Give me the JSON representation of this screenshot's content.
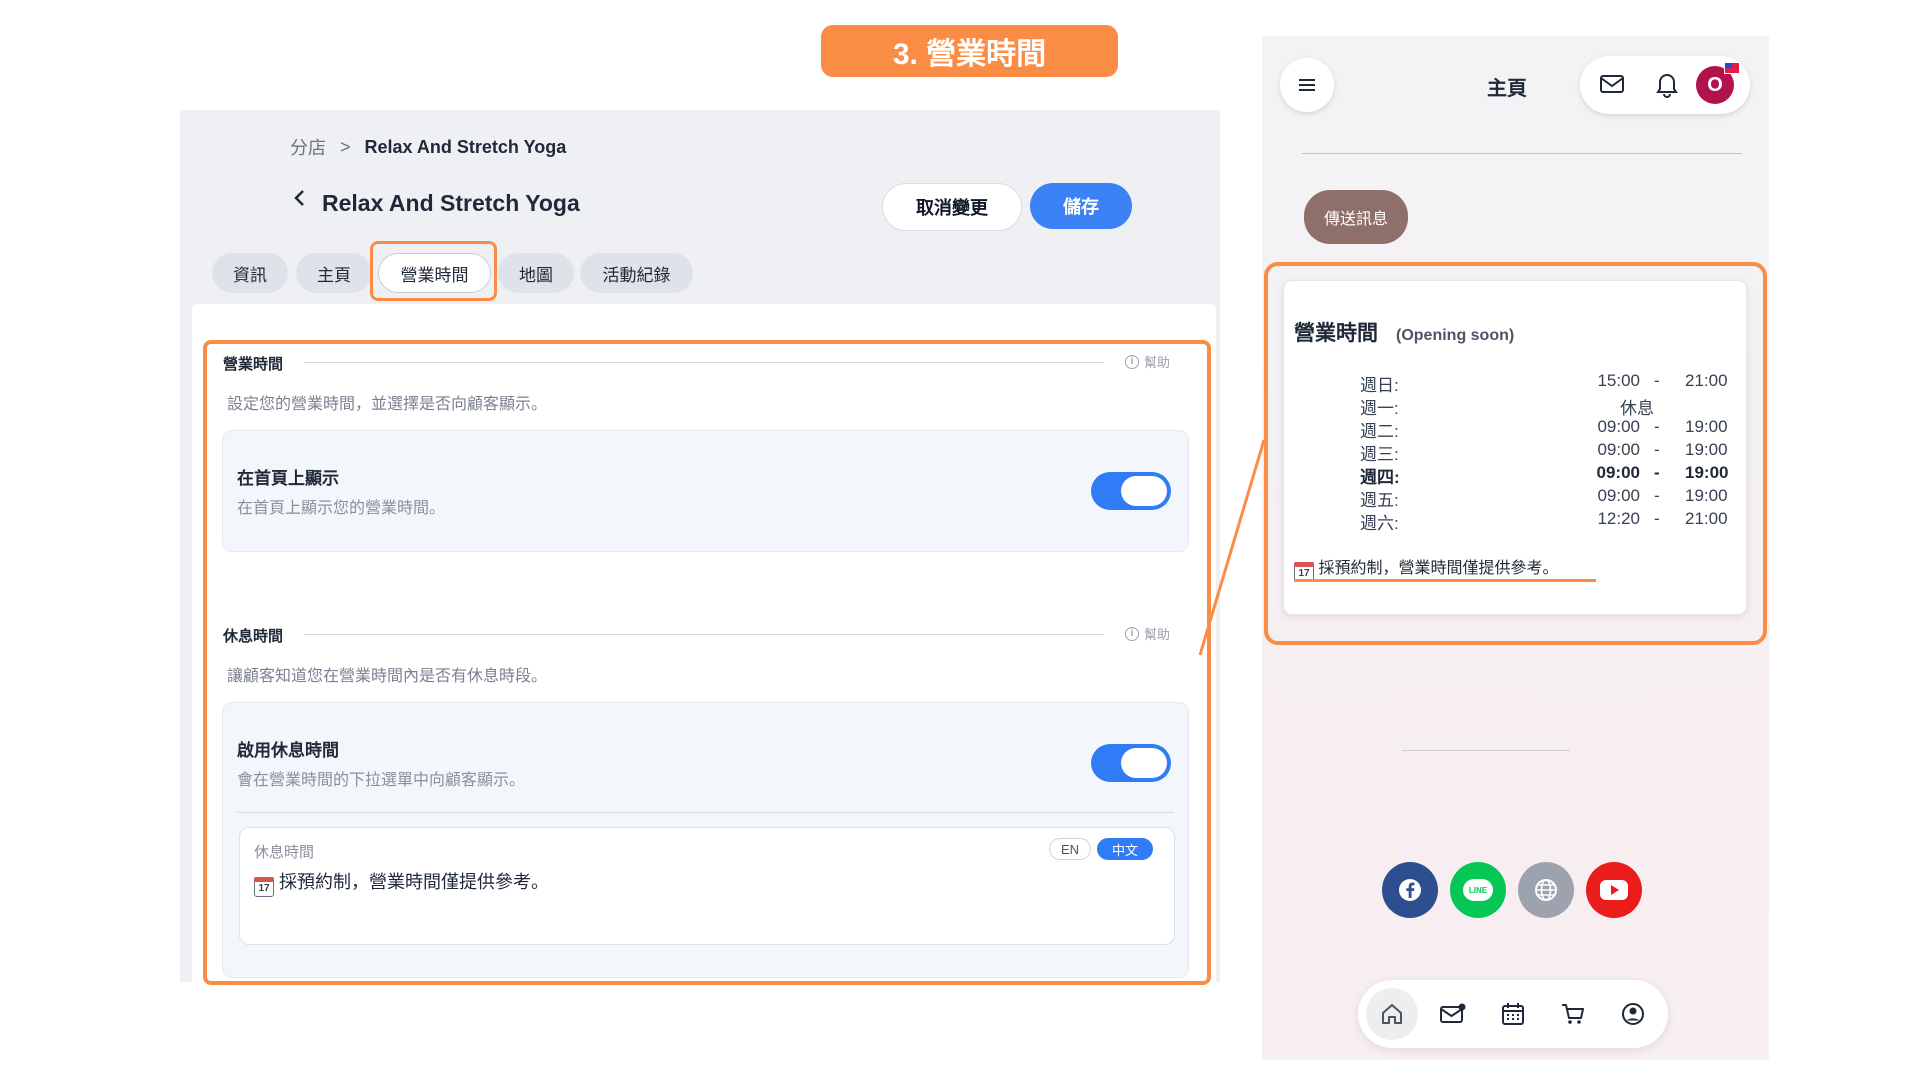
{
  "step_badge": "3. 營業時間",
  "admin": {
    "breadcrumb": {
      "parent": "分店",
      "separator": ">",
      "current": "Relax And Stretch Yoga"
    },
    "title": "Relax And Stretch Yoga",
    "cancel_label": "取消變更",
    "save_label": "儲存",
    "tabs": [
      {
        "label": "資訊"
      },
      {
        "label": "主頁"
      },
      {
        "label": "營業時間",
        "active": true
      },
      {
        "label": "地圖"
      },
      {
        "label": "活動紀錄"
      }
    ],
    "opening_section": {
      "title": "營業時間",
      "help": "幫助",
      "description": "設定您的營業時間，並選擇是否向顧客顯示。",
      "setting_label": "在首頁上顯示",
      "setting_desc": "在首頁上顯示您的營業時間。",
      "enabled": true
    },
    "break_section": {
      "title": "休息時間",
      "help": "幫助",
      "description": "讓顧客知道您在營業時間內是否有休息時段。",
      "setting_label": "啟用休息時間",
      "setting_desc": "會在營業時間的下拉選單中向顧客顯示。",
      "enabled": true,
      "editor_label": "休息時間",
      "lang_en": "EN",
      "lang_zh": "中文",
      "calendar_day": "17",
      "editor_text": "採預約制，營業時間僅提供參考。"
    }
  },
  "phone": {
    "title": "主頁",
    "avatar_letter": "O",
    "send_message": "傳送訊息",
    "hours_title": "營業時間",
    "hours_status": "(Opening soon)",
    "dash": "-",
    "days": [
      {
        "day": "週日:",
        "open": "15:00",
        "close": "21:00"
      },
      {
        "day": "週一:",
        "closed": "休息"
      },
      {
        "day": "週二:",
        "open": "09:00",
        "close": "19:00"
      },
      {
        "day": "週三:",
        "open": "09:00",
        "close": "19:00"
      },
      {
        "day": "週四:",
        "open": "09:00",
        "close": "19:00",
        "today": true
      },
      {
        "day": "週五:",
        "open": "09:00",
        "close": "19:00"
      },
      {
        "day": "週六:",
        "open": "12:20",
        "close": "21:00"
      }
    ],
    "calendar_day": "17",
    "note": "採預約制，營業時間僅提供參考。",
    "socials": [
      "facebook-icon",
      "line-icon",
      "globe-icon",
      "youtube-icon"
    ],
    "social_colors": {
      "facebook": "#2d4f8f",
      "line": "#06c755",
      "globe": "#9ca3af",
      "youtube": "#ea1c1c"
    },
    "line_label": "LINE",
    "nav": [
      "home-icon",
      "mail-icon",
      "calendar-icon",
      "cart-icon",
      "account-icon"
    ]
  },
  "colors": {
    "accent": "#fb8c46",
    "primary": "#2f7cf6"
  }
}
